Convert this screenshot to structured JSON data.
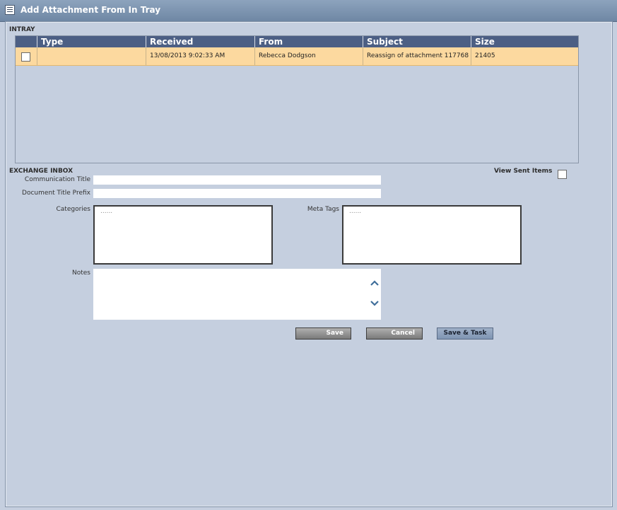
{
  "window": {
    "title": "Add Attachment From In Tray"
  },
  "intray": {
    "label": "INTRAY",
    "columns": [
      "Type",
      "Received",
      "From",
      "Subject",
      "Size"
    ],
    "rows": [
      {
        "selected": false,
        "type": "",
        "received": "13/08/2013 9:02:33 AM",
        "from": "Rebecca Dodgson",
        "subject": "Reassign of attachment 117768",
        "size": "21405"
      }
    ]
  },
  "exchange": {
    "label": "EXCHANGE INBOX",
    "view_sent_label": "View Sent Items",
    "view_sent_checked": false
  },
  "form": {
    "communication_title_label": "Communication Title",
    "communication_title_value": "",
    "document_title_prefix_label": "Document Title Prefix",
    "document_title_prefix_value": "",
    "categories_label": "Categories",
    "categories_placeholder": "......",
    "meta_tags_label": "Meta Tags",
    "meta_tags_placeholder": "......",
    "notes_label": "Notes",
    "notes_value": ""
  },
  "buttons": {
    "save": "Save",
    "cancel": "Cancel",
    "save_task": "Save & Task"
  },
  "icons": {
    "title": "window-list-icon",
    "notes_up": "chevron-up-icon",
    "notes_down": "chevron-down-icon"
  },
  "colors": {
    "background": "#c5cfdf",
    "titlebar": "#7890ae",
    "grid_header": "#4c5f84",
    "selected_row": "#fcd99f"
  }
}
